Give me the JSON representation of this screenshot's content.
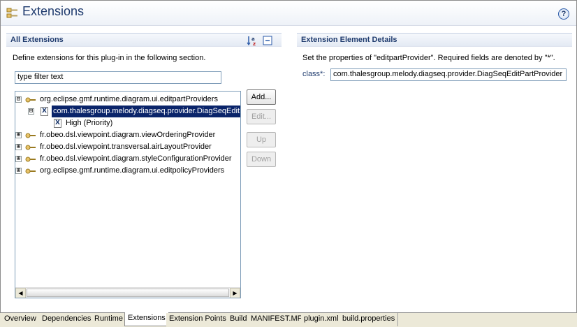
{
  "header": {
    "title": "Extensions",
    "help_icon": "question-circle-icon",
    "help_glyph": "?"
  },
  "all_extensions": {
    "title": "All Extensions",
    "description": "Define extensions for this plug-in in the following section.",
    "filter_value": "type filter text",
    "toolbar_icons": [
      "sort-az-icon",
      "collapse-all-icon"
    ],
    "tree": [
      {
        "label": "org.eclipse.gmf.runtime.diagram.ui.editpartProviders",
        "expander": "⊟",
        "type": "extension",
        "indent": 0
      },
      {
        "label": "com.thalesgroup.melody.diagseq.provider.DiagSeqEditP",
        "expander": "⊟",
        "type": "element",
        "indent": 1,
        "selected": true
      },
      {
        "label": "High (Priority)",
        "expander": "",
        "type": "element",
        "indent": 2
      },
      {
        "label": "fr.obeo.dsl.viewpoint.diagram.viewOrderingProvider",
        "expander": "⊞",
        "type": "extension",
        "indent": 0
      },
      {
        "label": "fr.obeo.dsl.viewpoint.transversal.airLayoutProvider",
        "expander": "⊞",
        "type": "extension",
        "indent": 0
      },
      {
        "label": "fr.obeo.dsl.viewpoint.diagram.styleConfigurationProvider",
        "expander": "⊞",
        "type": "extension",
        "indent": 0
      },
      {
        "label": "org.eclipse.gmf.runtime.diagram.ui.editpolicyProviders",
        "expander": "⊞",
        "type": "extension",
        "indent": 0
      }
    ],
    "buttons": {
      "add": "Add...",
      "edit": "Edit...",
      "up": "Up",
      "down": "Down"
    },
    "scroll_left": "◀",
    "scroll_right": "▶"
  },
  "details": {
    "title": "Extension Element Details",
    "description": "Set the properties of \"editpartProvider\". Required fields are denoted by \"*\".",
    "class_label": "class*:",
    "class_value": "com.thalesgroup.melody.diagseq.provider.DiagSeqEditPartProvider"
  },
  "tabs": [
    {
      "label": "Overview",
      "active": false
    },
    {
      "label": "Dependencies",
      "active": false
    },
    {
      "label": "Runtime",
      "active": false
    },
    {
      "label": "Extensions",
      "active": true
    },
    {
      "label": "Extension Points",
      "active": false
    },
    {
      "label": "Build",
      "active": false
    },
    {
      "label": "MANIFEST.MF",
      "active": false
    },
    {
      "label": "plugin.xml",
      "active": false
    },
    {
      "label": "build.properties",
      "active": false
    }
  ],
  "colors": {
    "header_text": "#1f3b6e",
    "selection": "#0a246a",
    "key_icon": "#d4a017"
  }
}
